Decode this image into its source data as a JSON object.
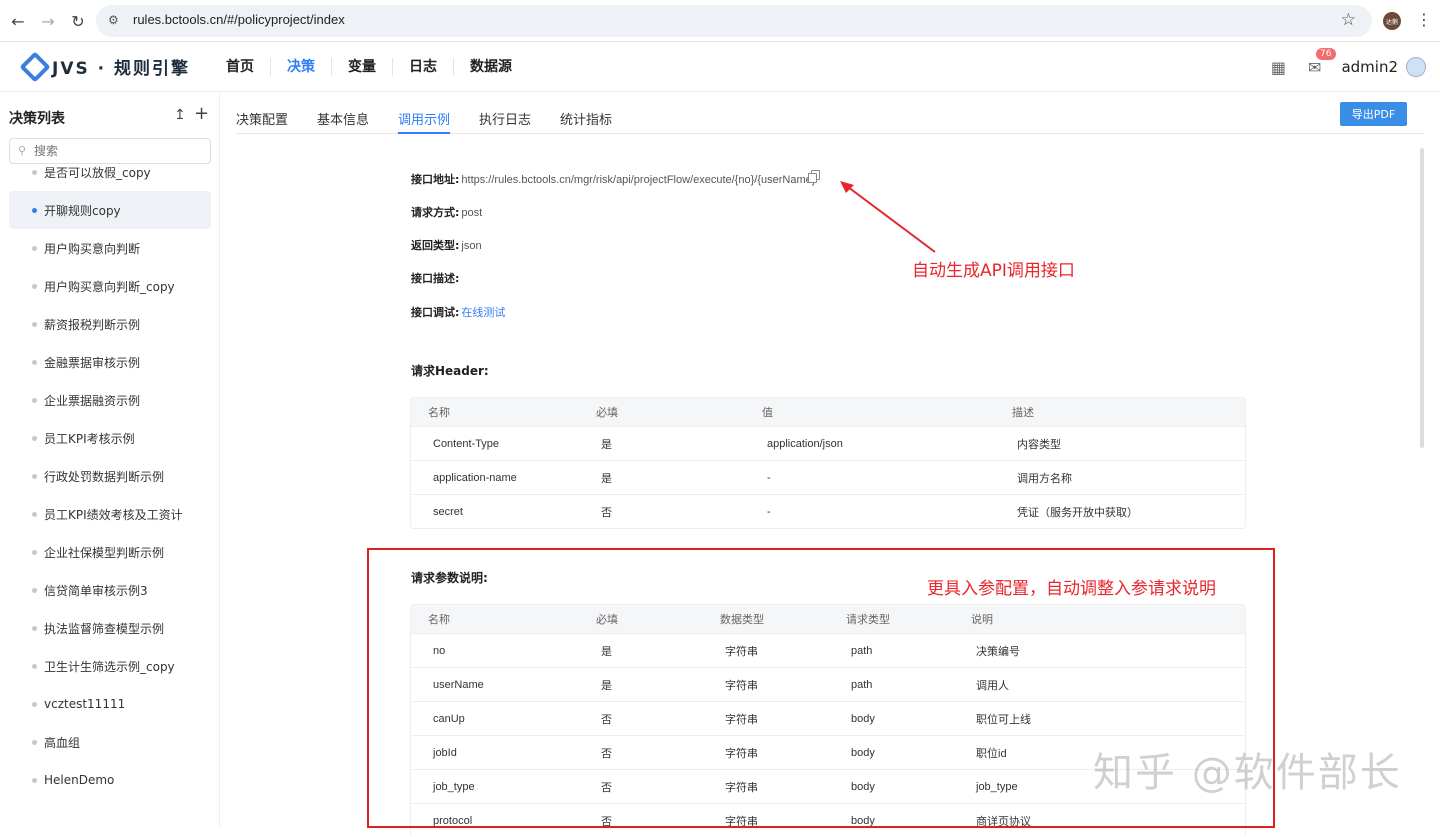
{
  "browser": {
    "url": "rules.bctools.cn/#/policyproject/index",
    "profile_label": "达鹅"
  },
  "app": {
    "logo_text": "JVS · 规则引擎",
    "nav": [
      "首页",
      "决策",
      "变量",
      "日志",
      "数据源"
    ],
    "active_nav": "决策",
    "notification_count": "76",
    "username": "admin2"
  },
  "sidebar": {
    "title": "决策列表",
    "search_placeholder": "搜索",
    "items": [
      "是否可以放假_copy",
      "开聊规则copy",
      "用户购买意向判断",
      "用户购买意向判断_copy",
      "薪资报税判断示例",
      "金融票据审核示例",
      "企业票据融资示例",
      "员工KPI考核示例",
      "行政处罚数据判断示例",
      "员工KPI绩效考核及工资计",
      "企业社保模型判断示例",
      "信贷简单审核示例3",
      "执法监督筛查模型示例",
      "卫生计生筛选示例_copy",
      "vcztest11111",
      "高血组",
      "HelenDemo"
    ],
    "active_index": 1
  },
  "tabs": [
    "决策配置",
    "基本信息",
    "调用示例",
    "执行日志",
    "统计指标"
  ],
  "active_tab": "调用示例",
  "export_button": "导出PDF",
  "api_info": {
    "address_label": "接口地址:",
    "address_value": "https://rules.bctools.cn/mgr/risk/api/projectFlow/execute/{no}/{userName}",
    "method_label": "请求方式:",
    "method_value": "post",
    "return_label": "返回类型:",
    "return_value": "json",
    "desc_label": "接口描述:",
    "desc_value": "",
    "debug_label": "接口调试:",
    "debug_link": "在线测试"
  },
  "header_section": {
    "title": "请求Header:",
    "columns": [
      "名称",
      "必填",
      "值",
      "描述"
    ],
    "rows": [
      [
        "Content-Type",
        "是",
        "application/json",
        "内容类型"
      ],
      [
        "application-name",
        "是",
        "-",
        "调用方名称"
      ],
      [
        "secret",
        "否",
        "-",
        "凭证（服务开放中获取）"
      ]
    ]
  },
  "params_section": {
    "title": "请求参数说明:",
    "columns": [
      "名称",
      "必填",
      "数据类型",
      "请求类型",
      "说明"
    ],
    "rows": [
      [
        "no",
        "是",
        "字符串",
        "path",
        "决策编号"
      ],
      [
        "userName",
        "是",
        "字符串",
        "path",
        "调用人"
      ],
      [
        "canUp",
        "否",
        "字符串",
        "body",
        "职位可上线"
      ],
      [
        "jobId",
        "否",
        "字符串",
        "body",
        "职位id"
      ],
      [
        "job_type",
        "否",
        "字符串",
        "body",
        "job_type"
      ],
      [
        "protocol",
        "否",
        "字符串",
        "body",
        "商详页协议"
      ]
    ]
  },
  "annotations": {
    "api_note": "自动生成API调用接口",
    "params_note": "更具入参配置，自动调整入参请求说明"
  },
  "watermark": "知乎 @软件部长",
  "colors": {
    "accent": "#2d7ef7",
    "annotation_red": "#e02020",
    "badge": "#f56c6c"
  }
}
